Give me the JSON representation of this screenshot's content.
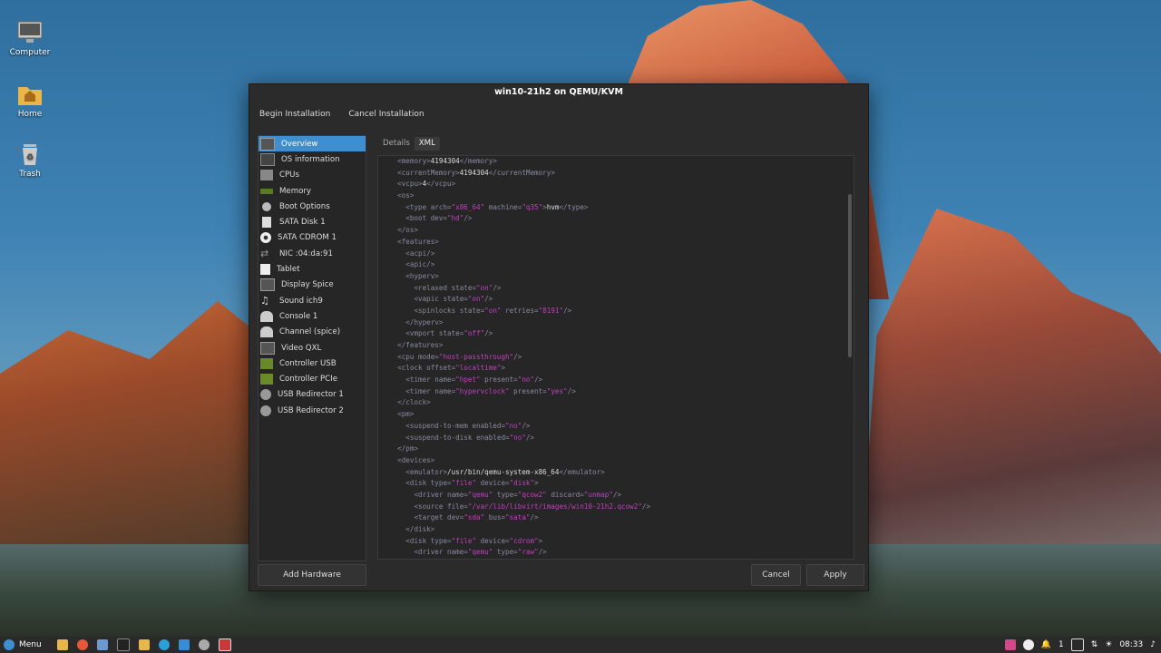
{
  "desktop": {
    "icons": [
      {
        "label": "Computer",
        "icon": "computer-icon"
      },
      {
        "label": "Home",
        "icon": "home-folder-icon"
      },
      {
        "label": "Trash",
        "icon": "trash-icon"
      }
    ]
  },
  "window": {
    "title": "win10-21h2 on QEMU/KVM",
    "toolbar": {
      "begin": "Begin Installation",
      "cancel": "Cancel Installation"
    },
    "sidebar": [
      {
        "label": "Overview",
        "icon": "overview-icon",
        "selected": true
      },
      {
        "label": "OS information",
        "icon": "os-info-icon"
      },
      {
        "label": "CPUs",
        "icon": "cpu-icon"
      },
      {
        "label": "Memory",
        "icon": "memory-icon"
      },
      {
        "label": "Boot Options",
        "icon": "boot-icon"
      },
      {
        "label": "SATA Disk 1",
        "icon": "disk-icon"
      },
      {
        "label": "SATA CDROM 1",
        "icon": "cdrom-icon"
      },
      {
        "label": "NIC :04:da:91",
        "icon": "nic-icon"
      },
      {
        "label": "Tablet",
        "icon": "tablet-icon"
      },
      {
        "label": "Display Spice",
        "icon": "display-icon"
      },
      {
        "label": "Sound ich9",
        "icon": "sound-icon"
      },
      {
        "label": "Console 1",
        "icon": "console-icon"
      },
      {
        "label": "Channel (spice)",
        "icon": "channel-icon"
      },
      {
        "label": "Video QXL",
        "icon": "video-icon"
      },
      {
        "label": "Controller USB",
        "icon": "controller-icon"
      },
      {
        "label": "Controller PCIe",
        "icon": "controller-icon"
      },
      {
        "label": "USB Redirector 1",
        "icon": "usb-redirector-icon"
      },
      {
        "label": "USB Redirector 2",
        "icon": "usb-redirector-icon"
      }
    ],
    "tabs": [
      "Details",
      "XML"
    ],
    "active_tab": "XML",
    "xml_lines": [
      "  <memory>4194304</memory>",
      "  <currentMemory>4194304</currentMemory>",
      "  <vcpu>4</vcpu>",
      "  <os>",
      "    <type arch=\"x86_64\" machine=\"q35\">hvm</type>",
      "    <boot dev=\"hd\"/>",
      "  </os>",
      "  <features>",
      "    <acpi/>",
      "    <apic/>",
      "    <hyperv>",
      "      <relaxed state=\"on\"/>",
      "      <vapic state=\"on\"/>",
      "      <spinlocks state=\"on\" retries=\"8191\"/>",
      "    </hyperv>",
      "    <vmport state=\"off\"/>",
      "  </features>",
      "  <cpu mode=\"host-passthrough\"/>",
      "  <clock offset=\"localtime\">",
      "    <timer name=\"hpet\" present=\"no\"/>",
      "    <timer name=\"hypervclock\" present=\"yes\"/>",
      "  </clock>",
      "  <pm>",
      "    <suspend-to-mem enabled=\"no\"/>",
      "    <suspend-to-disk enabled=\"no\"/>",
      "  </pm>",
      "  <devices>",
      "    <emulator>/usr/bin/qemu-system-x86_64</emulator>",
      "    <disk type=\"file\" device=\"disk\">",
      "      <driver name=\"qemu\" type=\"qcow2\" discard=\"unmap\"/>",
      "      <source file=\"/var/lib/libvirt/images/win10-21h2.qcow2\"/>",
      "      <target dev=\"sda\" bus=\"sata\"/>",
      "    </disk>",
      "    <disk type=\"file\" device=\"cdrom\">",
      "      <driver name=\"qemu\" type=\"raw\"/>"
    ],
    "buttons": {
      "add_hardware": "Add Hardware",
      "cancel": "Cancel",
      "apply": "Apply"
    }
  },
  "taskbar": {
    "menu_label": "Menu",
    "clock": "08:33",
    "tray_count": "1"
  }
}
